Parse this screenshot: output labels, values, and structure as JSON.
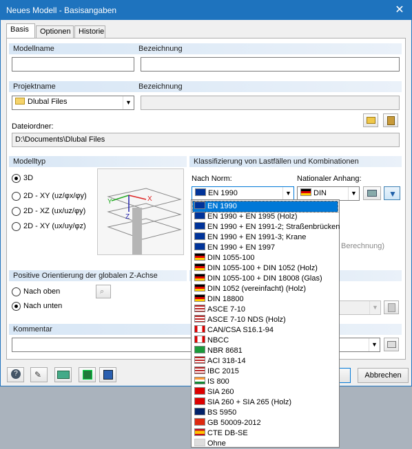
{
  "window": {
    "title": "Neues Modell - Basisangaben",
    "close_glyph": "✕"
  },
  "tabs": [
    {
      "label": "Basis"
    },
    {
      "label": "Optionen"
    },
    {
      "label": "Historie"
    }
  ],
  "modell": {
    "name_label": "Modellname",
    "name_value": "",
    "bez_label": "Bezeichnung",
    "bez_value": ""
  },
  "projekt": {
    "name_label": "Projektname",
    "name_value": "Dlubal Files",
    "bez_label": "Bezeichnung",
    "bez_value": "",
    "folder_label": "Dateiordner:",
    "folder_value": "D:\\Documents\\Dlubal Files"
  },
  "modelltyp": {
    "header": "Modelltyp",
    "options": [
      {
        "label": "3D",
        "selected": true
      },
      {
        "label": "2D - XY (uz/φx/φy)",
        "selected": false
      },
      {
        "label": "2D - XZ (ux/uz/φy)",
        "selected": false
      },
      {
        "label": "2D - XY (ux/uy/φz)",
        "selected": false
      }
    ]
  },
  "klassifizierung": {
    "header": "Klassifizierung von Lastfällen und Kombinationen",
    "norm_label": "Nach Norm:",
    "norm_value": "EN 1990",
    "anhang_label": "Nationaler Anhang:",
    "anhang_value": "DIN",
    "hidden_text": "Berechnung)"
  },
  "orientierung": {
    "header": "Positive Orientierung der globalen Z-Achse",
    "options": [
      {
        "label": "Nach oben",
        "selected": false
      },
      {
        "label": "Nach unten",
        "selected": true
      }
    ]
  },
  "kommentar": {
    "header": "Kommentar",
    "value": ""
  },
  "footer": {
    "cancel_label": "Abbrechen"
  },
  "dropdown": {
    "items": [
      {
        "label": "EN 1990",
        "flag": "eu",
        "selected": true
      },
      {
        "label": "EN 1990 + EN 1995 (Holz)",
        "flag": "eu"
      },
      {
        "label": "EN 1990 + EN 1991-2; Straßenbrücken",
        "flag": "eu"
      },
      {
        "label": "EN 1990 + EN 1991-3; Krane",
        "flag": "eu"
      },
      {
        "label": "EN 1990 + EN 1997",
        "flag": "eu"
      },
      {
        "label": "DIN 1055-100",
        "flag": "de"
      },
      {
        "label": "DIN 1055-100 + DIN 1052 (Holz)",
        "flag": "de"
      },
      {
        "label": "DIN 1055-100 + DIN 18008 (Glas)",
        "flag": "de"
      },
      {
        "label": "DIN 1052 (vereinfacht) (Holz)",
        "flag": "de"
      },
      {
        "label": "DIN 18800",
        "flag": "de"
      },
      {
        "label": "ASCE 7-10",
        "flag": "us"
      },
      {
        "label": "ASCE 7-10 NDS (Holz)",
        "flag": "us"
      },
      {
        "label": "CAN/CSA S16.1-94",
        "flag": "ca"
      },
      {
        "label": "NBCC",
        "flag": "ca"
      },
      {
        "label": "NBR 8681",
        "flag": "br"
      },
      {
        "label": "ACI 318-14",
        "flag": "us"
      },
      {
        "label": "IBC 2015",
        "flag": "us"
      },
      {
        "label": "IS 800",
        "flag": "in"
      },
      {
        "label": "SIA 260",
        "flag": "ch"
      },
      {
        "label": "SIA 260 + SIA 265 (Holz)",
        "flag": "ch"
      },
      {
        "label": "BS 5950",
        "flag": "gb"
      },
      {
        "label": "GB 50009-2012",
        "flag": "cn"
      },
      {
        "label": "CTE DB-SE",
        "flag": "es"
      },
      {
        "label": "Ohne",
        "flag": "none"
      }
    ]
  },
  "colors": {
    "accent": "#1e73be",
    "selection": "#0078d7",
    "section_header": "#d7e6f5"
  }
}
